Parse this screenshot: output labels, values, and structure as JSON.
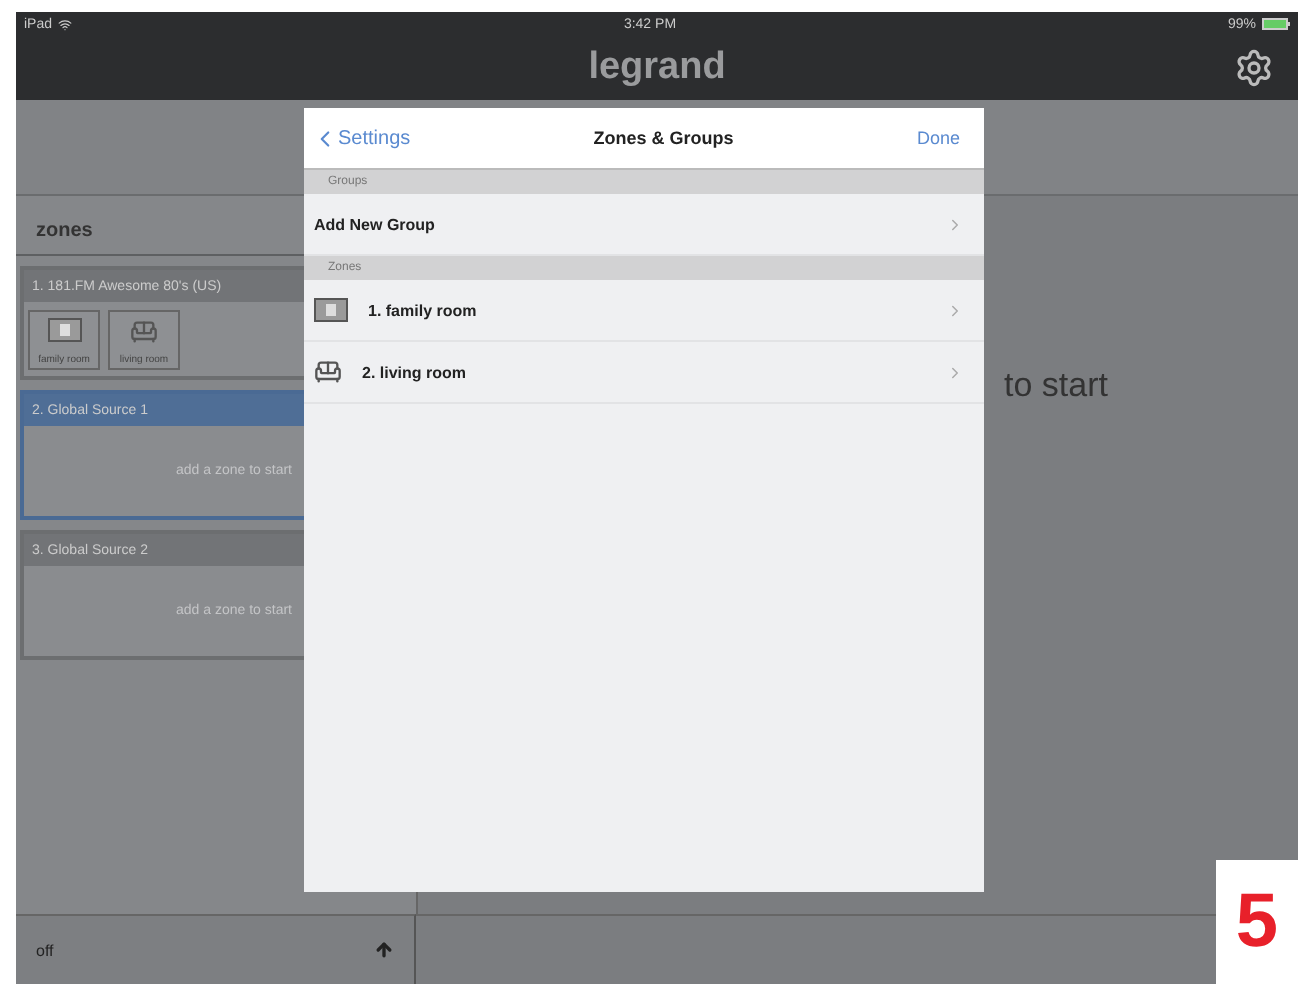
{
  "status_bar": {
    "device": "iPad",
    "time": "3:42 PM",
    "battery": "99%"
  },
  "header": {
    "logo": "legrand"
  },
  "sidebar": {
    "title": "zones",
    "cards": [
      {
        "title": "1. 181.FM Awesome 80's (US)",
        "selected": false,
        "rooms": [
          {
            "label": "family room",
            "kind": "tv"
          },
          {
            "label": "living room",
            "kind": "sofa"
          }
        ]
      },
      {
        "title": "2. Global Source 1",
        "selected": true,
        "hint": "add a zone to start"
      },
      {
        "title": "3. Global Source 2",
        "selected": false,
        "hint": "add a zone to start"
      }
    ],
    "power": "off"
  },
  "main": {
    "hint": "to start"
  },
  "dialog": {
    "back": "Settings",
    "title": "Zones & Groups",
    "done": "Done",
    "sections": [
      {
        "header": "Groups",
        "rows": [
          {
            "label": "Add New Group"
          }
        ]
      },
      {
        "header": "Zones",
        "rows": [
          {
            "label": "1. family room",
            "kind": "tv"
          },
          {
            "label": "2. living room",
            "kind": "sofa"
          }
        ]
      }
    ]
  },
  "step_number": "5"
}
